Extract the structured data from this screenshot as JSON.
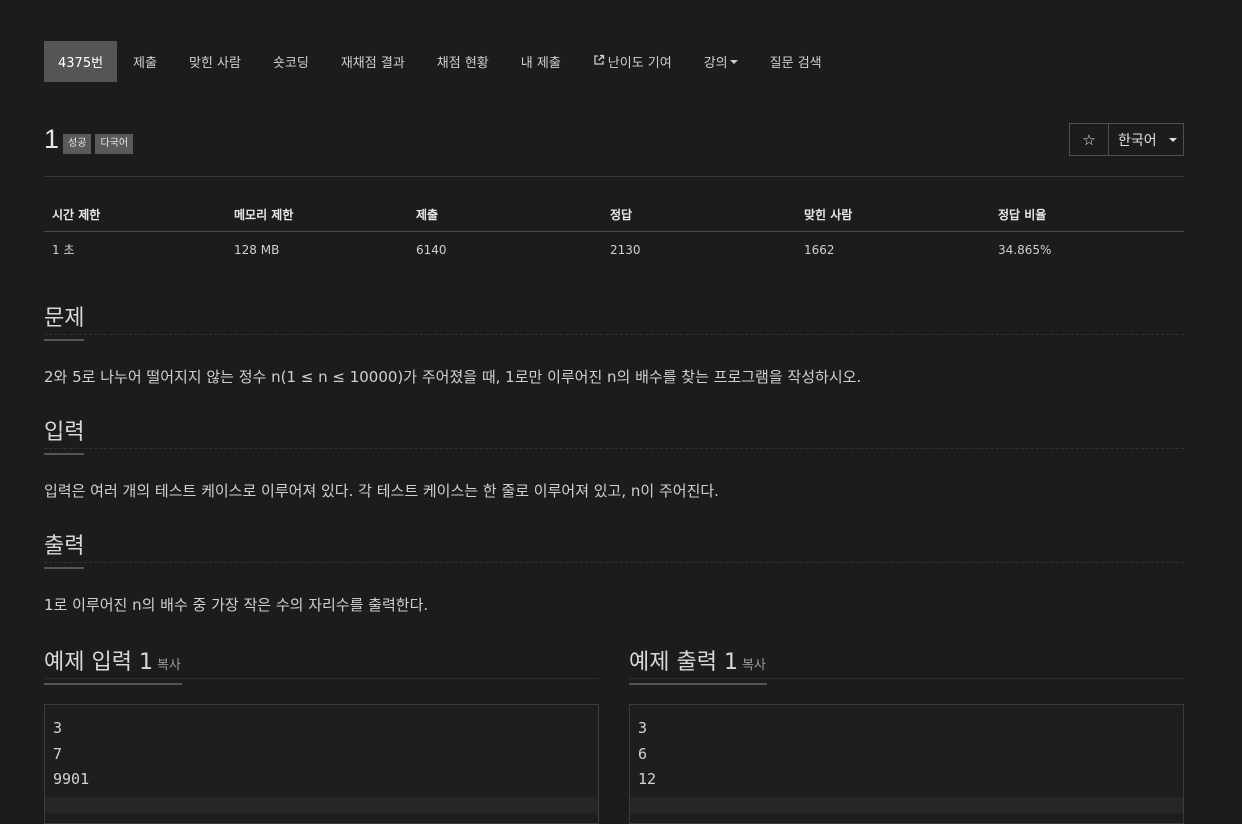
{
  "nav": {
    "tabs": [
      {
        "label": "4375번",
        "active": true
      },
      {
        "label": "제출"
      },
      {
        "label": "맞힌 사람"
      },
      {
        "label": "숏코딩"
      },
      {
        "label": "재채점 결과"
      },
      {
        "label": "채점 현황"
      },
      {
        "label": "내 제출"
      },
      {
        "label": "난이도 기여",
        "icon": "external-link-icon"
      },
      {
        "label": "강의",
        "dropdown": true
      },
      {
        "label": "질문 검색"
      }
    ]
  },
  "problem": {
    "id": "1",
    "badges": [
      "성공",
      "다국어"
    ]
  },
  "controls": {
    "star": "☆",
    "language": "한국어"
  },
  "info_table": {
    "headers": [
      "시간 제한",
      "메모리 제한",
      "제출",
      "정답",
      "맞힌 사람",
      "정답 비율"
    ],
    "values": [
      "1 초",
      "128 MB",
      "6140",
      "2130",
      "1662",
      "34.865%"
    ]
  },
  "sections": {
    "problem_title": "문제",
    "problem_text": "2와 5로 나누어 떨어지지 않는 정수 n(1 ≤ n ≤ 10000)가 주어졌을 때, 1로만 이루어진 n의 배수를 찾는 프로그램을 작성하시오.",
    "input_title": "입력",
    "input_text": "입력은 여러 개의 테스트 케이스로 이루어져 있다. 각 테스트 케이스는 한 줄로 이루어져 있고, n이 주어진다.",
    "output_title": "출력",
    "output_text": "1로 이루어진 n의 배수 중 가장 작은 수의 자리수를 출력한다."
  },
  "samples": {
    "input_title": "예제 입력 1",
    "output_title": "예제 출력 1",
    "copy_label": "복사",
    "input_lines": [
      "3",
      "7",
      "9901"
    ],
    "output_lines": [
      "3",
      "6",
      "12"
    ]
  }
}
